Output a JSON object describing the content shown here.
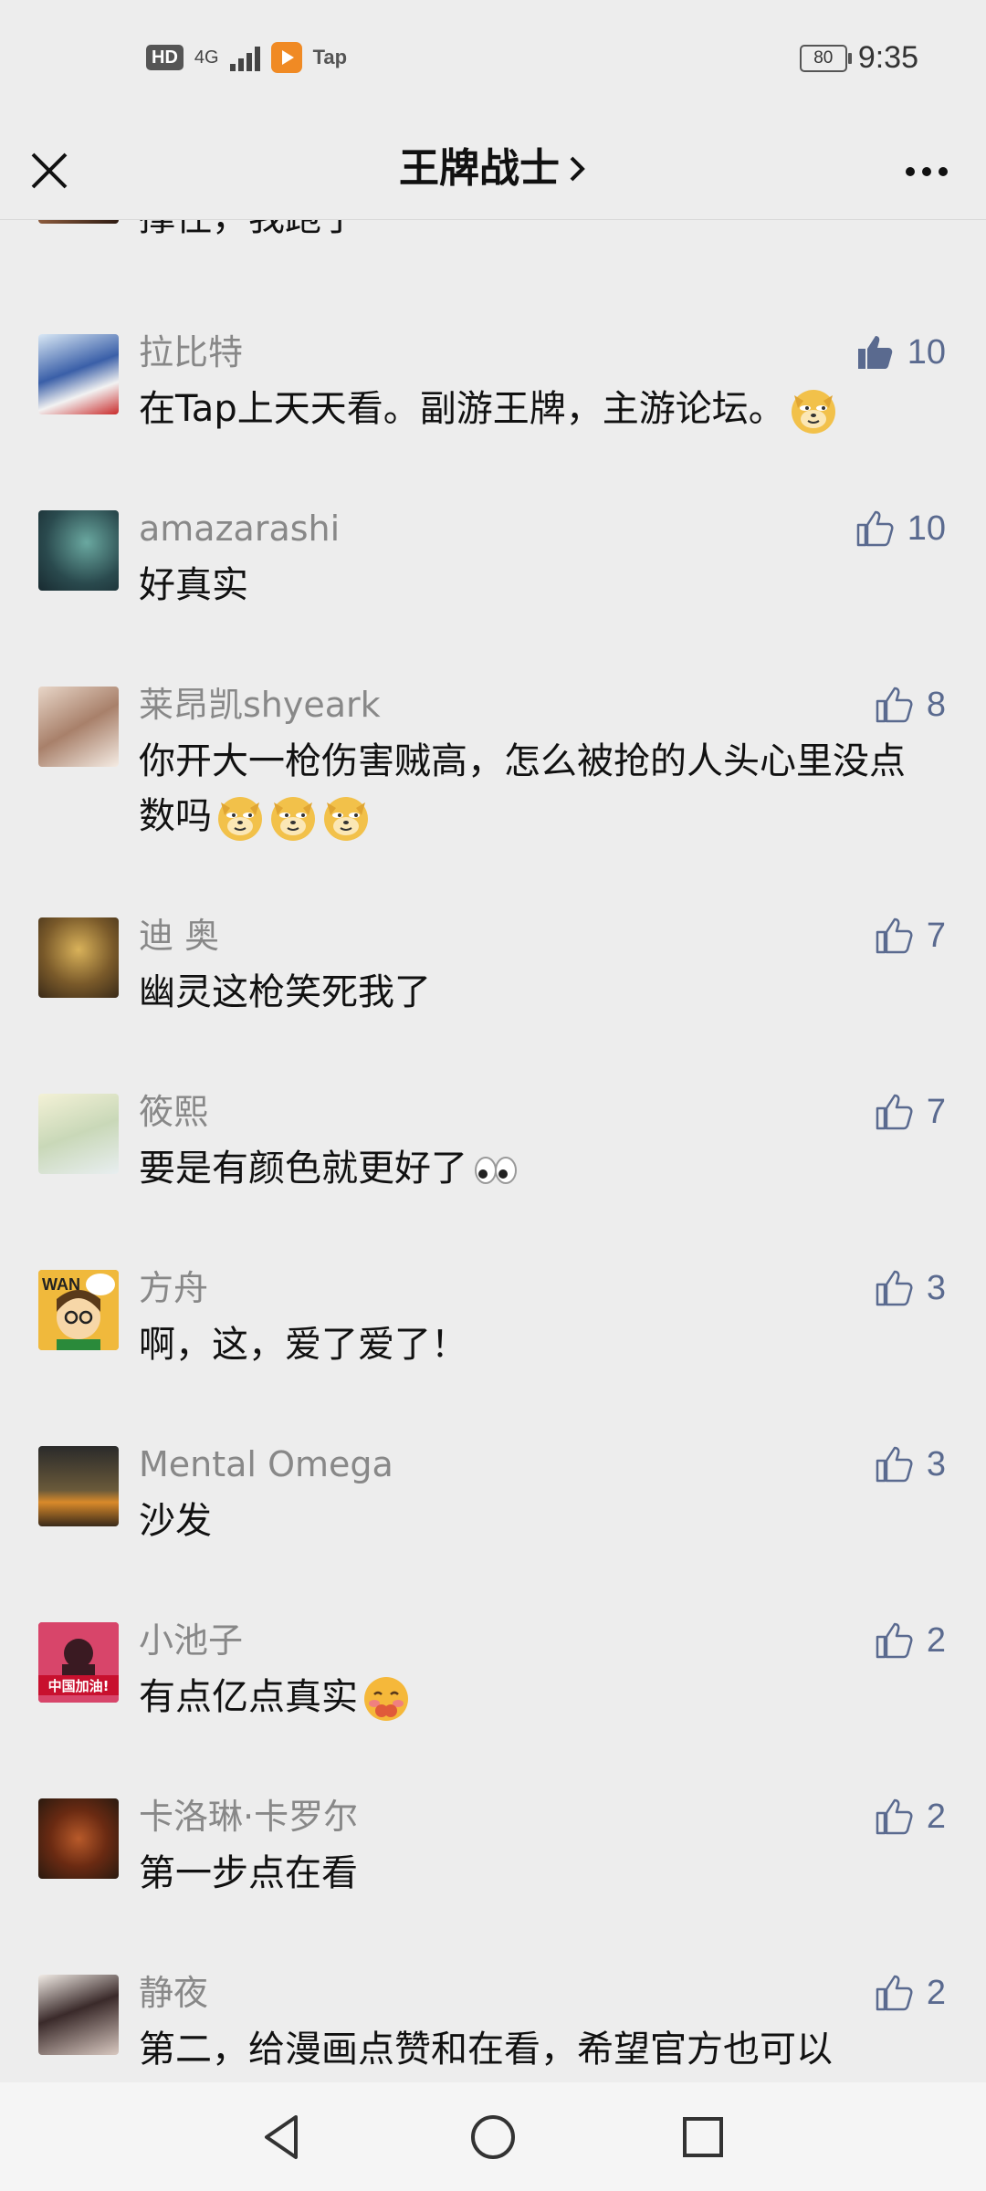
{
  "status_bar": {
    "hd": "HD",
    "network": "4G",
    "tap_label": "Tap",
    "battery": "80",
    "time": "9:35"
  },
  "header": {
    "title": "王牌战士",
    "close_icon": "close-icon",
    "more_icon": "more-icon"
  },
  "partial_comment": {
    "text": "撑住，我跑了"
  },
  "comments": [
    {
      "username": "拉比特",
      "text": "在Tap上天天看。副游王牌，主游论坛。",
      "likes": "10",
      "liked": true,
      "emoji_count": 1,
      "emoji": "doge-emoji"
    },
    {
      "username": "amazarashi",
      "text": "好真实",
      "likes": "10",
      "liked": false,
      "emoji_count": 0
    },
    {
      "username": "莱昂凯shyeark",
      "text": "你开大一枪伤害贼高，怎么被抢的人头心里没点数吗",
      "likes": "8",
      "liked": false,
      "emoji_count": 3,
      "emoji": "doge-emoji"
    },
    {
      "username": "迪 奥",
      "text": "幽灵这枪笑死我了",
      "likes": "7",
      "liked": false,
      "emoji_count": 0
    },
    {
      "username": "筱熙",
      "text": "要是有颜色就更好了",
      "likes": "7",
      "liked": false,
      "emoji_count": 1,
      "emoji": "eyes-emoji"
    },
    {
      "username": "方舟",
      "text": "啊，这，爱了爱了！",
      "likes": "3",
      "liked": false,
      "emoji_count": 0
    },
    {
      "username": "Mental Omega",
      "text": "沙发",
      "likes": "3",
      "liked": false,
      "emoji_count": 0
    },
    {
      "username": "小池子",
      "text": "有点亿点真实",
      "likes": "2",
      "liked": false,
      "emoji_count": 1,
      "emoji": "shy-emoji"
    },
    {
      "username": "卡洛琳·卡罗尔",
      "text": "第一步点在看",
      "likes": "2",
      "liked": false,
      "emoji_count": 0
    },
    {
      "username": "静夜",
      "text": "第二，给漫画点赞和在看，希望官方也可以",
      "likes": "2",
      "liked": false,
      "emoji_count": 0
    }
  ],
  "avatar_labels": {
    "fangzhou": "WAN",
    "xiaochizi": "中国加油!"
  },
  "colors": {
    "background": "#ededed",
    "like_active": "#5a6a8f",
    "username": "#888888"
  },
  "navbar": {
    "back_icon": "back-triangle-icon",
    "home_icon": "home-circle-icon",
    "recents_icon": "recents-square-icon"
  }
}
